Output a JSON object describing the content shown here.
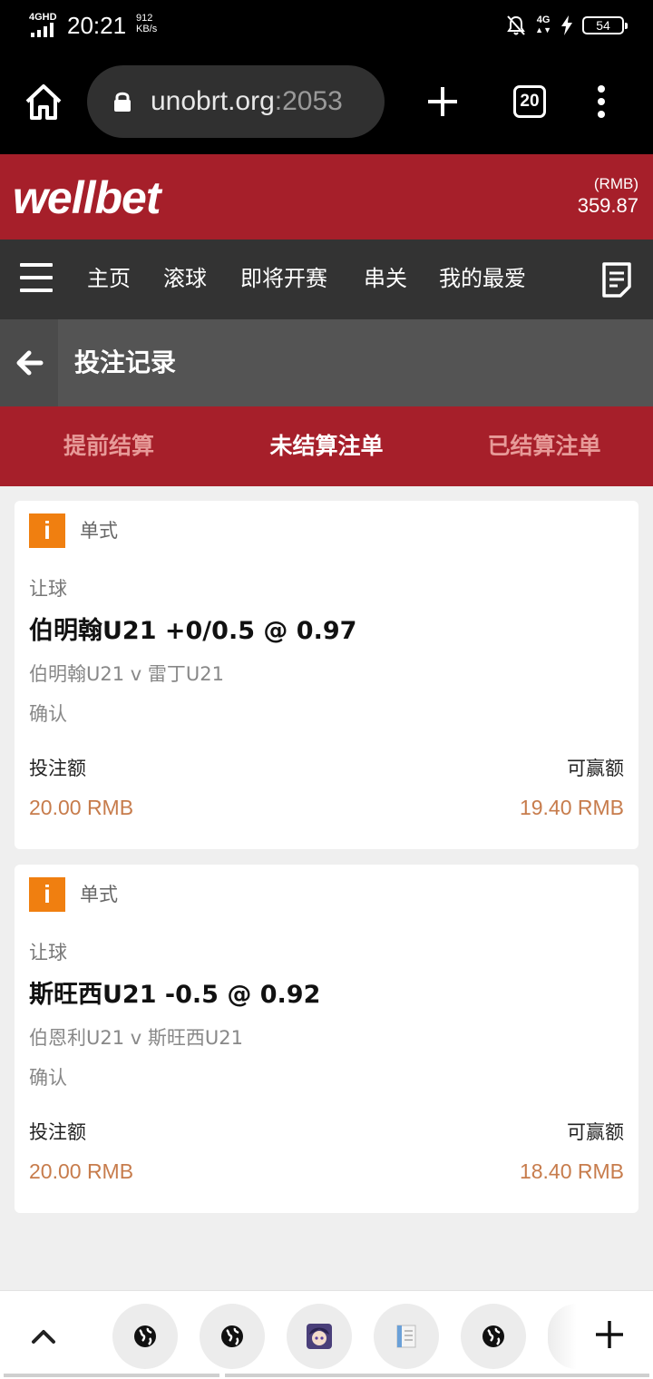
{
  "status_bar": {
    "network": "4GHD",
    "time": "20:21",
    "speed_value": "912",
    "speed_unit": "KB/s",
    "network_right": "4G",
    "battery": "54"
  },
  "browser": {
    "url_host": "unobrt.org",
    "url_port": ":2053",
    "tab_count": "20"
  },
  "brand": {
    "logo": "wellbet",
    "currency": "(RMB)",
    "balance": "359.87"
  },
  "nav": {
    "items": [
      "主页",
      "滚球",
      "即将开赛",
      "串关",
      "我的最爱"
    ]
  },
  "page": {
    "title": "投注记录"
  },
  "subtabs": [
    {
      "label": "提前结算",
      "active": false
    },
    {
      "label": "未结算注单",
      "active": true
    },
    {
      "label": "已结算注单",
      "active": false
    }
  ],
  "bets": [
    {
      "type": "单式",
      "market": "让球",
      "selection": "伯明翰U21 +0/0.5 @ 0.97",
      "match": "伯明翰U21 v 雷丁U21",
      "status": "确认",
      "stake_label": "投注额",
      "win_label": "可赢额",
      "stake": "20.00 RMB",
      "to_win": "19.40 RMB"
    },
    {
      "type": "单式",
      "market": "让球",
      "selection": "斯旺西U21 -0.5 @ 0.92",
      "match": "伯恩利U21 v 斯旺西U21",
      "status": "确认",
      "stake_label": "投注额",
      "win_label": "可赢额",
      "stake": "20.00 RMB",
      "to_win": "18.40 RMB"
    }
  ],
  "colors": {
    "brand_red": "#a61f2a",
    "nav_dark": "#333333",
    "title_gray": "#545454",
    "accent_orange": "#f07f10",
    "amount_color": "#c77c4c"
  },
  "icons": {
    "info": "i",
    "tab_thumbs": [
      "globe-icon",
      "globe-icon",
      "avatar-icon",
      "document-icon",
      "globe-icon"
    ]
  }
}
